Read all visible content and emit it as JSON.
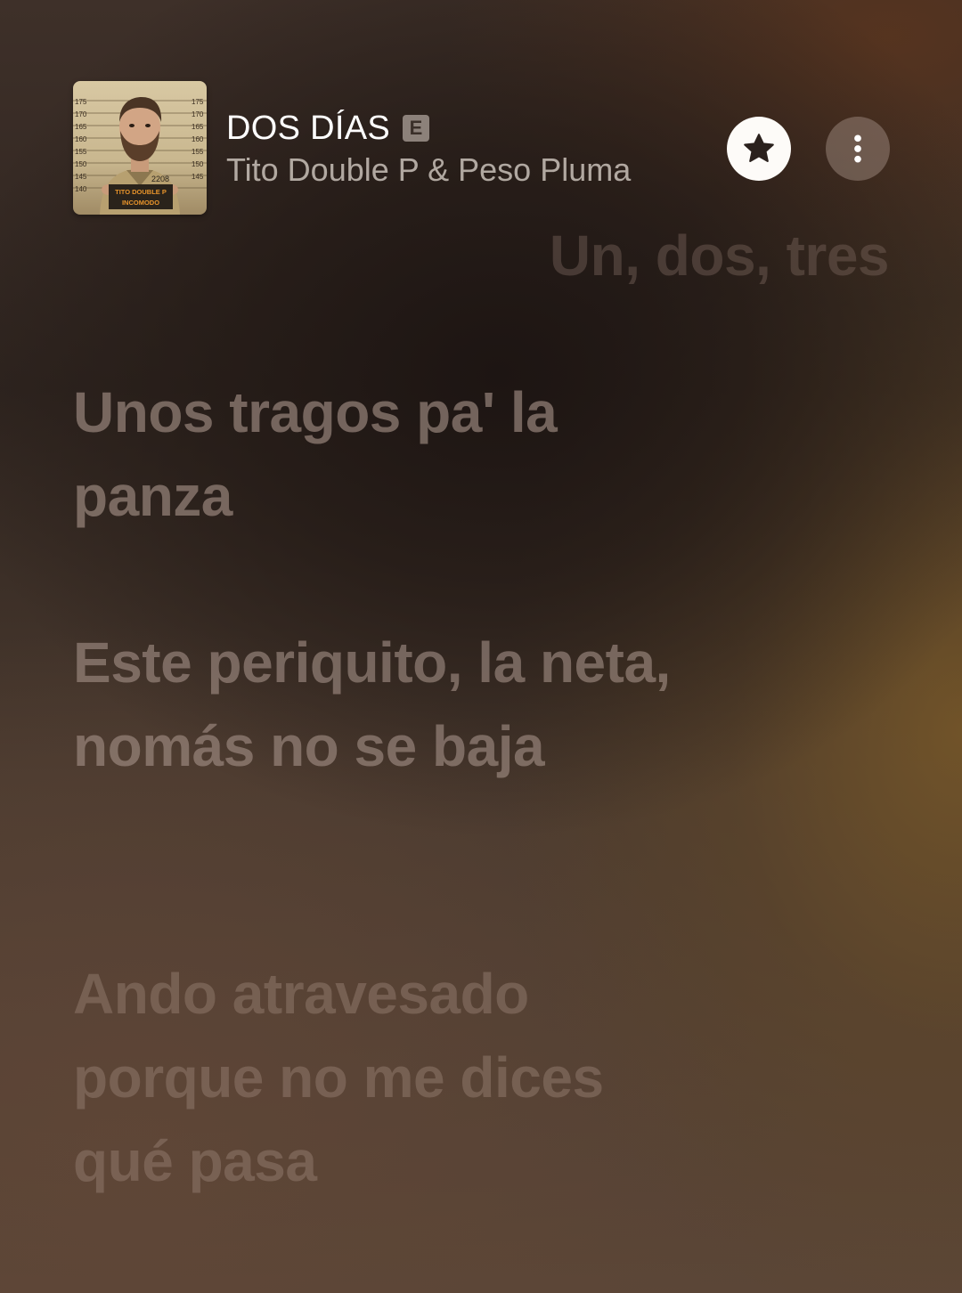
{
  "now_playing": {
    "title": "DOS DÍAS",
    "explicit_label": "E",
    "artist": "Tito Double P & Peso Pluma",
    "artwork": {
      "icon": "album-artwork-icon",
      "booking_number": "2208",
      "placard_line1": "TITO DOUBLE P",
      "placard_line2": "INCOMODO",
      "height_marks": [
        "175",
        "170",
        "165",
        "160",
        "155",
        "150",
        "145",
        "140"
      ]
    }
  },
  "controls": {
    "favorite_icon": "star-icon",
    "more_icon": "more-vertical-icon"
  },
  "lyrics": {
    "previous_line": "Un, dos, tres",
    "lines": [
      "Unos tragos pa' la panza",
      "Este periquito, la neta, nomás no se baja",
      "Ando atravesado porque no me dices qué pasa"
    ]
  }
}
